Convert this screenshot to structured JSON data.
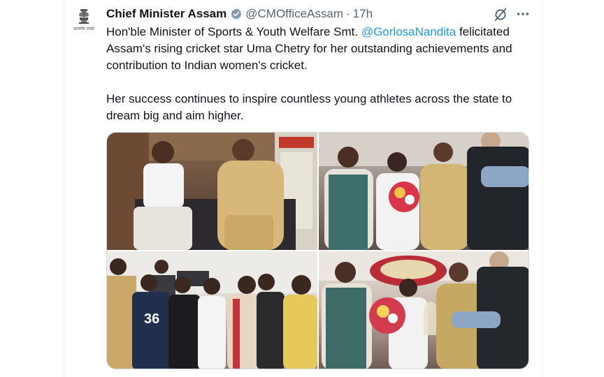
{
  "tweet": {
    "author_name": "Chief Minister Assam",
    "author_handle": "@CMOfficeAssam",
    "separator": "·",
    "timestamp": "17h",
    "avatar_motto": "सत्यमेव जयते",
    "text_line_1_prefix": "Hon'ble Minister of Sports & Youth Welfare Smt. ",
    "mention": "@GorlosaNandita",
    "text_line_2": "felicitated Assam's rising cricket star Uma Chetry for her outstanding achievements and contribution to Indian women's cricket.",
    "text_para_2": "Her success continues to inspire countless young athletes across the state to dream big and aim higher."
  },
  "photos": {
    "p3_jersey_number": "36"
  },
  "icons": [
    "verified-badge-icon",
    "grok-icon",
    "more-options-icon"
  ],
  "colors": {
    "link": "#1d9bf0",
    "verified": "#829aab",
    "muted": "#536471"
  }
}
